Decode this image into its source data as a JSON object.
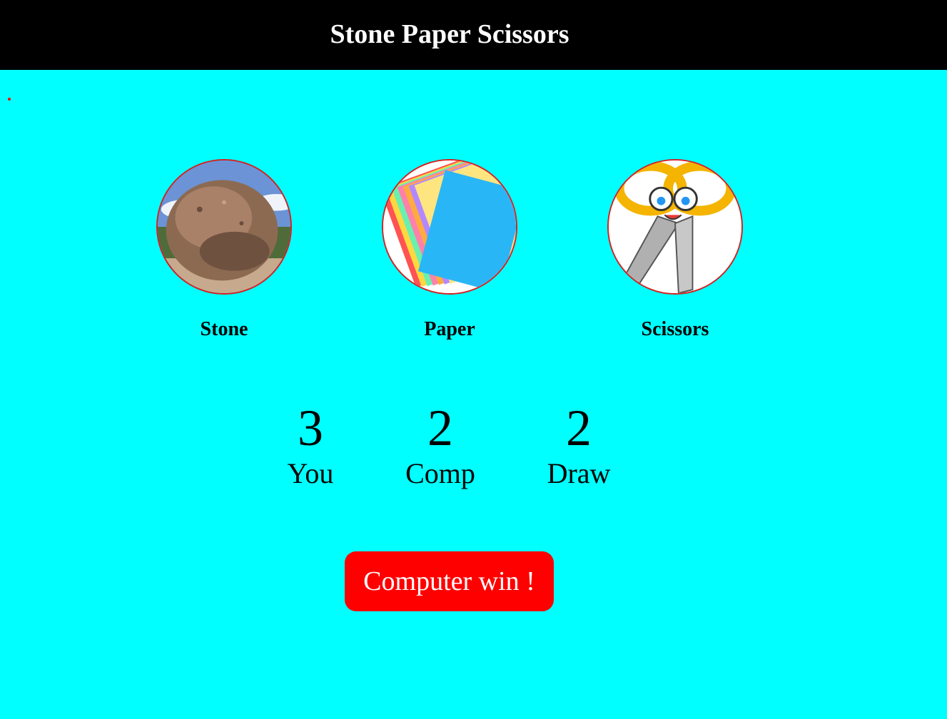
{
  "header": {
    "title": "Stone Paper Scissors"
  },
  "choices": [
    {
      "label": "Stone",
      "icon": "stone-image"
    },
    {
      "label": "Paper",
      "icon": "paper-image"
    },
    {
      "label": "Scissors",
      "icon": "scissors-image"
    }
  ],
  "scores": [
    {
      "value": "3",
      "label": "You"
    },
    {
      "value": "2",
      "label": "Comp"
    },
    {
      "value": "2",
      "label": "Draw"
    }
  ],
  "message": {
    "text": "Computer win !",
    "color": "#ff0000"
  },
  "colors": {
    "background": "#00ffff",
    "header": "#000000",
    "border": "#d61f1f"
  }
}
